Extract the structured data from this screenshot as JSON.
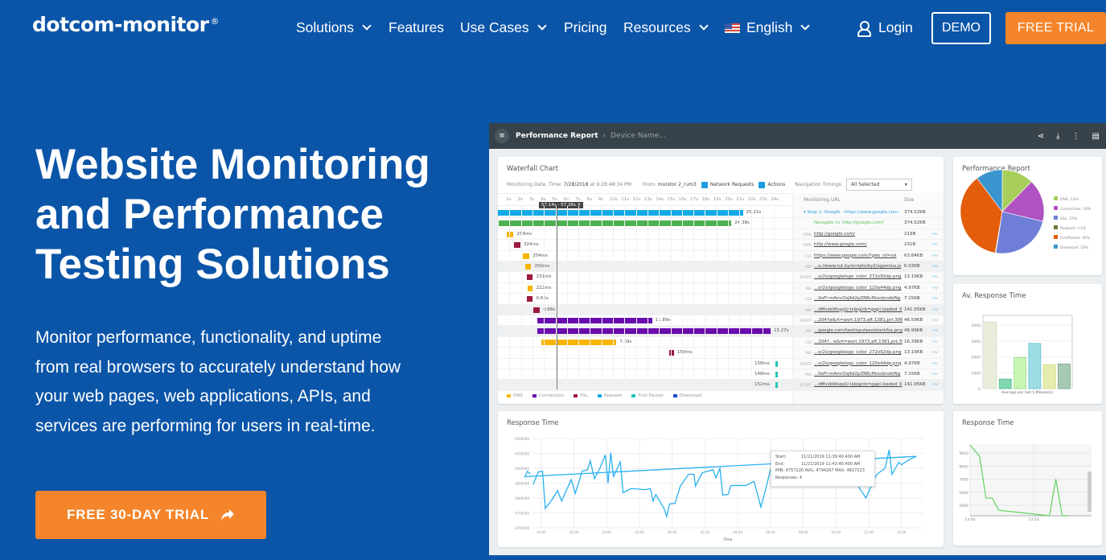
{
  "nav": {
    "logo": "dotcom-monitor",
    "logo_mark": "®",
    "items": [
      {
        "label": "Solutions",
        "dropdown": true
      },
      {
        "label": "Features",
        "dropdown": false
      },
      {
        "label": "Use Cases",
        "dropdown": true
      },
      {
        "label": "Pricing",
        "dropdown": false
      },
      {
        "label": "Resources",
        "dropdown": true
      }
    ],
    "language": "English",
    "login": "Login",
    "demo": "DEMO",
    "free_trial": "FREE TRIAL"
  },
  "hero": {
    "title_lines": [
      "Website Monitoring",
      "and Performance",
      "Testing Solutions"
    ],
    "lead_lines": [
      "Monitor performance, functionality, and uptime",
      "from real browsers to accurately understand how",
      "your web pages, web applications, APIs, and",
      "services are performing for users in real-time."
    ],
    "cta": "FREE 30-DAY TRIAL",
    "cta_icon": "share-arrow-icon"
  },
  "colors": {
    "background": "#0b55a8",
    "accent": "#f5852a"
  },
  "dashboard": {
    "header": {
      "title": "Performance Report",
      "crumb": "Device Name...",
      "icons": [
        "share-icon",
        "download-icon",
        "more-icon",
        "chat-icon"
      ]
    },
    "waterfall": {
      "title": "Waterfall Chart",
      "date_label": "Monitoring Date, Time:",
      "date": "7/28/2018",
      "time": "at 9:28:48:34 PM",
      "from_label": "From:",
      "from": "monitor 2_rum3",
      "network_requests": "Network Requests",
      "actions": "Actions",
      "nav_timings_label": "Navigation Timings",
      "nav_timings": "All Selected",
      "col_url": "Monitoring URL",
      "col_size": "Size",
      "cursor_label": "57.14s - 57.26s",
      "ticks": [
        "1s",
        "2s",
        "3s",
        "4s",
        "5s",
        "6s",
        "7s",
        "8s",
        "9s",
        "10s",
        "11s",
        "12s",
        "13s",
        "14s",
        "15s",
        "16s",
        "17s",
        "18s",
        "19s",
        "20s",
        "21s",
        "22s",
        "23s",
        "24s"
      ],
      "rows": [
        {
          "label": "25.22s",
          "type": "",
          "url": "Step 1: Google - https://www.google.com.",
          "size": "374.52KB",
          "start": 0,
          "dur": 21.3,
          "color": "#12a9e6",
          "kind": "step"
        },
        {
          "label": "24.38s",
          "type": "",
          "url": "Navigate to 'http://google.com/'",
          "size": "374.52KB",
          "start": 0.1,
          "dur": 20.2,
          "color": "#4caf50",
          "kind": "nav"
        },
        {
          "label": "254ms",
          "type": "HTML",
          "url": "http://google.com/",
          "size": "219B",
          "start": 0.8,
          "dur": 0.55,
          "color": "#f7b500"
        },
        {
          "label": "324ms",
          "type": "HTML",
          "url": "http://www.google.com/",
          "size": "231B",
          "start": 1.4,
          "dur": 0.55,
          "color": "#9c1a3c"
        },
        {
          "label": "254ms",
          "type": "CSS",
          "url": "https://www.google.com/?gws_rd=ssl",
          "size": "63.84KB",
          "start": 2.2,
          "dur": 0.55,
          "color": "#f7b500"
        },
        {
          "label": "200ms",
          "type": "IMG",
          "url": "...s://www.tut.by/scripts/by2/xgemius.js",
          "size": "6.03KB",
          "start": 2.4,
          "dur": 0.5,
          "color": "#f7b500"
        },
        {
          "label": "231ms",
          "type": "SCRIPT",
          "url": "...o/2x/googlelogo_color_272x92dp.png",
          "size": "13.19KB",
          "start": 2.5,
          "dur": 0.55,
          "color": "#9c1a3c"
        },
        {
          "label": "222ms",
          "type": "IMG",
          "url": "...o/2x/googlelogo_color_120x44dp.png",
          "size": "4.97KB",
          "start": 2.6,
          "dur": 0.45,
          "color": "#f7b500"
        },
        {
          "label": "0.65s",
          "type": "CSS",
          "url": "...0oFl-mAmrOq9d2pZRBcPbocbnzbiNg",
          "size": "7.15KB",
          "start": 2.5,
          "dur": 0.55,
          "color": "#9c1a3c"
        },
        {
          "label": "0.68s",
          "type": "IMG",
          "url": "...dMvsbWxppU-lxJeg/cb=gapi.loaded_0",
          "size": "141.05KB",
          "start": 3.1,
          "dur": 0.55,
          "color": "#9c1a3c"
        },
        {
          "label": "11.89s",
          "type": "SCRIPT",
          "url": "...204?w&rt=wsrt.1973,aft.1381,prt.3964",
          "size": "46.59KB",
          "start": 3.4,
          "dur": 10.0,
          "color": "#6a0dad"
        },
        {
          "label": "15.27s",
          "type": "IMG",
          "url": "...google.com/textinputassistant/tia.png",
          "size": "46.99KB",
          "start": 3.4,
          "dur": 20.3,
          "color": "#6a0dad"
        },
        {
          "label": "7.09s",
          "type": "CSS",
          "url": "...204?...w&rt=wsrt.1973,aft.1381,prt.396",
          "size": "16.39KB",
          "start": 3.8,
          "dur": 6.5,
          "color": "#f7b500"
        },
        {
          "label": "150ms",
          "type": "IMG",
          "url": "...o/2x/googlelogo_color_272x92dp.png",
          "size": "13.19KB",
          "start": 14.9,
          "dur": 0.4,
          "color": "#9c1a3c"
        },
        {
          "label": "158ms",
          "type": "SCRIPT",
          "url": "...o/2x/googlelogo_color_120x44dp.png",
          "size": "4.97KB",
          "start": 25.0,
          "dur": 0.2,
          "color": "#1ec6b6",
          "label_left": true
        },
        {
          "label": "148ms",
          "type": "IMG",
          "url": "...0oFl-mAmrOq9d2pZRBcPbocbnzbiNg",
          "size": "7.15KB",
          "start": 25.0,
          "dur": 0.2,
          "color": "#1ec6b6",
          "label_left": true
        },
        {
          "label": "152ms",
          "type": "SCRIPT",
          "url": "...dMvsbWxppU-lxJeg/cb=gapi.loaded_0",
          "size": "141.05KB",
          "start": 25.0,
          "dur": 0.2,
          "color": "#1ec6b6",
          "label_left": true
        }
      ],
      "legend": [
        {
          "name": "DNS",
          "color": "#f7b500"
        },
        {
          "name": "Connection",
          "color": "#6a0dad"
        },
        {
          "name": "SSL",
          "color": "#9c1a3c"
        },
        {
          "name": "Request",
          "color": "#12a9e6"
        },
        {
          "name": "First Packet",
          "color": "#1ec6b6"
        },
        {
          "name": "Download",
          "color": "#1f4fd1"
        }
      ]
    },
    "pie": {
      "title": "Performance Report",
      "slices": [
        {
          "name": "DNS: 12%",
          "value": 12,
          "color": "#a8cf5b"
        },
        {
          "name": "Connection: 16%",
          "value": 16,
          "color": "#b152c2"
        },
        {
          "name": "SSL: 23%",
          "value": 23,
          "color": "#6f7fd8"
        },
        {
          "name": "Request: <1%",
          "value": 0.3,
          "color": "#6b7a3a"
        },
        {
          "name": "FirstPacket: 36%",
          "value": 36,
          "color": "#e35d0b"
        },
        {
          "name": "Download: 10%",
          "value": 10,
          "color": "#3a95cf"
        }
      ]
    },
    "avg": {
      "title": "Av. Response Time",
      "xlabel": "Average per last 5 Minute(s)",
      "yticks": [
        0,
        1000,
        2000,
        3000,
        4000
      ],
      "bars": [
        {
          "value": 4200,
          "color": "#e8ecd8",
          "stroke": "#cfd6b8"
        },
        {
          "value": 600,
          "color": "#7fd6b0",
          "stroke": "#3fae80"
        },
        {
          "value": 1950,
          "color": "#c9f5b5",
          "stroke": "#7fd46a"
        },
        {
          "value": 2850,
          "color": "#9fdde6",
          "stroke": "#3fb3c6"
        },
        {
          "value": 1500,
          "color": "#e6ecae",
          "stroke": "#c6cf6a"
        },
        {
          "value": 1550,
          "color": "#a6c9b4",
          "stroke": "#5e8f72"
        }
      ]
    },
    "response": {
      "title": "Response Time",
      "xlabel": "Time",
      "yticks": [
        4700000,
        4750000,
        4800000,
        4850000,
        4900000,
        4950000,
        5000000
      ],
      "xticks": [
        "16:00",
        "18:00",
        "20:00",
        "22:00",
        "00:00",
        "02:00",
        "04:00",
        "06:00",
        "08:00",
        "10:00",
        "12:00",
        "14:00"
      ],
      "tooltip": {
        "start_label": "Start:",
        "start": "11/21/2019 11:39:40.400 AM",
        "end_label": "End:",
        "end": "11/21/2019 11:43:40.400 AM",
        "stats": "MIN: 4757220 AVG: 4794267 MAX: 4827223",
        "responses_label": "Responses:",
        "responses": "4"
      },
      "points": [
        [
          "15:30",
          4845000
        ],
        [
          "15:50",
          4888000
        ],
        [
          "16:05",
          4890000
        ],
        [
          "16:15",
          4765000
        ],
        [
          "16:40",
          4795000
        ],
        [
          "17:00",
          4825000
        ],
        [
          "17:15",
          4790000
        ],
        [
          "17:50",
          4862000
        ],
        [
          "18:05",
          4815000
        ],
        [
          "18:30",
          4890000
        ],
        [
          "18:50",
          4895000
        ],
        [
          "19:00",
          4925000
        ],
        [
          "19:15",
          4865000
        ],
        [
          "19:35",
          4900000
        ],
        [
          "19:55",
          4945000
        ],
        [
          "20:05",
          4850000
        ],
        [
          "20:15",
          4952000
        ],
        [
          "20:25",
          4872000
        ],
        [
          "20:50",
          4922000
        ],
        [
          "21:00",
          4818000
        ],
        [
          "21:30",
          4832000
        ],
        [
          "22:20",
          4828000
        ],
        [
          "22:40",
          4832000
        ],
        [
          "22:50",
          4790000
        ],
        [
          "23:00",
          4812000
        ],
        [
          "23:30",
          4765000
        ],
        [
          "23:40",
          4738000
        ],
        [
          "23:50",
          4780000
        ],
        [
          "00:10",
          4782000
        ],
        [
          "00:30",
          4840000
        ],
        [
          "01:00",
          4880000
        ],
        [
          "01:20",
          4880000
        ],
        [
          "01:25",
          4840000
        ],
        [
          "01:50",
          4885000
        ],
        [
          "02:30",
          4895000
        ],
        [
          "02:40",
          4868000
        ],
        [
          "02:55",
          4900000
        ],
        [
          "03:05",
          4810000
        ],
        [
          "03:25",
          4812000
        ],
        [
          "03:35",
          4842000
        ],
        [
          "04:30",
          4842000
        ],
        [
          "05:00",
          4856000
        ],
        [
          "05:25",
          4770000
        ],
        [
          "05:40",
          4820000
        ],
        [
          "06:00",
          4895000
        ],
        [
          "07:00",
          4868000
        ],
        [
          "08:00",
          4860000
        ],
        [
          "08:30",
          4845000
        ],
        [
          "09:00",
          4852000
        ],
        [
          "10:00",
          4870000
        ],
        [
          "11:00",
          4870000
        ],
        [
          "11:50",
          4800000
        ],
        [
          "12:05",
          4832000
        ],
        [
          "12:30",
          4880000
        ],
        [
          "13:00",
          4900000
        ],
        [
          "13:15",
          4962000
        ],
        [
          "13:25",
          4880000
        ],
        [
          "13:50",
          4920000
        ],
        [
          "14:00",
          4912000
        ],
        [
          "14:30",
          4930000
        ],
        [
          "14:55",
          4940000
        ],
        [
          "15:00",
          4872000
        ],
        [
          "15:10",
          4890000
        ],
        [
          "15:20",
          4880000
        ]
      ]
    },
    "small": {
      "title": "Response Time",
      "yticks": [
        5000,
        6000,
        7000,
        8000,
        9000
      ],
      "xticks": [
        "13:40",
        "13:50"
      ],
      "points": [
        [
          "13:40",
          9600
        ],
        [
          "13:41.5",
          8750
        ],
        [
          "13:42.5",
          5550
        ],
        [
          "13:43.5",
          5550
        ],
        [
          "13:44.5",
          4620
        ],
        [
          "13:52.5",
          4200
        ],
        [
          "13:53.5",
          7000
        ],
        [
          "13:54.5",
          4200
        ],
        [
          "13:55.5",
          4220
        ]
      ]
    }
  }
}
